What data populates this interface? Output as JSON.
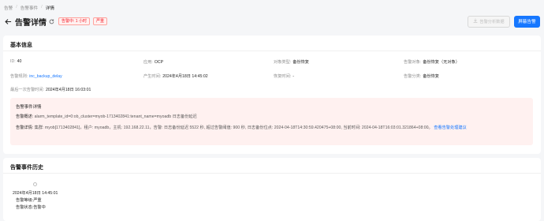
{
  "breadcrumb": [
    "告警",
    "告警事件",
    "详情"
  ],
  "header": {
    "title": "告警详情",
    "tags": [
      "告警中: 1 小时",
      "严重"
    ],
    "analyze_button": "告警分析数据",
    "close_button": "屏蔽告警"
  },
  "basic_info": {
    "title": "基本信息",
    "fields": {
      "id_label": "ID:",
      "id_value": "40",
      "app_label": "应用:",
      "app_value": "OCP",
      "object_type_label": "对象类型:",
      "object_type_value": "备份恢复",
      "alarm_object_label": "告警对象:",
      "alarm_object_value": "备份恢复（无对象）",
      "rule_label": "告警规则:",
      "rule_value": "inc_backup_delay",
      "created_label": "产生时间:",
      "created_value": "2024年4月18日 14:45:02",
      "recovered_label": "恢复时间:",
      "recovered_value": "-",
      "category_label": "告警分类:",
      "category_value": "备份恢复",
      "last_label": "最后一次告警时间:",
      "last_value": "2024年4月18日 16:03:01"
    },
    "detail": {
      "title": "告警事件详情",
      "summary_label": "告警概述:",
      "summary_value": "alarm_template_id=0:ob_cluster=myob-1713402841:tenant_name=myoadb 日志备份延迟",
      "detail_label": "告警详情:",
      "detail_value": "集群: myob[1713402841]，租户: myoadb，主机: 192.168.22.11，告警: 日志备份延迟 5522 秒, 超过告警阈值: 900 秒, 日志备份位点: 2024-04-18T14:30:59.420475+08:00, 当前时间: 2024-04-18T16:03:01.321864+08:00。",
      "link_text": "查看告警处理建议"
    }
  },
  "history": {
    "title": "告警事件历史",
    "items": [
      {
        "time": "2024年4月18日 14:45:01",
        "level_label": "告警等级:",
        "level_value": "严重",
        "status_label": "告警状态:",
        "status_value": "告警中"
      }
    ]
  },
  "colors": {
    "primary": "#1677ff",
    "danger": "#f5222d",
    "detail_bg": "#fff1f0"
  }
}
